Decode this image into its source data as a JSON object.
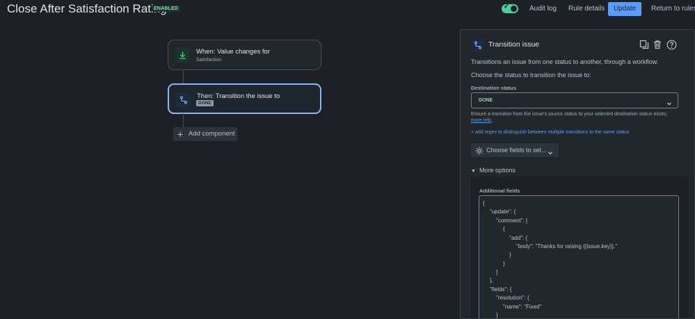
{
  "header": {
    "title": "Close After Satisfaction Rating",
    "status_badge": "ENABLED",
    "toggle_on": true,
    "audit_log": "Audit log",
    "rule_details": "Rule details",
    "update": "Update",
    "return": "Return to rules"
  },
  "canvas": {
    "trigger": {
      "title": "When: Value changes for",
      "subtitle": "Satisfaction"
    },
    "action": {
      "title": "Then: Transition the issue to",
      "chip": "DONE"
    },
    "add_component": "Add component"
  },
  "panel": {
    "title": "Transition issue",
    "description": "Transitions an issue from one status to another, through a workflow.",
    "choose_status": "Choose the status to transition the issue to:",
    "destination_label": "Destination status",
    "destination_value": "DONE",
    "help_text": "Ensure a transition from the issue's source status to your selected destination status exists;",
    "help_link": "more info",
    "regex_link": "+ add regex to distinguish between multiple transitions to the same status",
    "choose_fields": "Choose fields to set...",
    "more_options": "More options",
    "additional_fields_label": "Additional fields",
    "code_lines": [
      "{",
      "\"update\": {",
      "\"comment\": [",
      "{",
      "\"add\": {",
      "\"body\": \"Thanks for raising {{issue.key}}.\"",
      "}",
      "}",
      "]",
      "},",
      "\"fields\": {",
      "\"resolution\": {",
      "\"name\": \"Fixed\"",
      "}"
    ]
  },
  "colors": {
    "background": "#1d2125",
    "accent": "#579dff",
    "enabled": "#4bce97",
    "status_done": "#7ee2b8"
  }
}
